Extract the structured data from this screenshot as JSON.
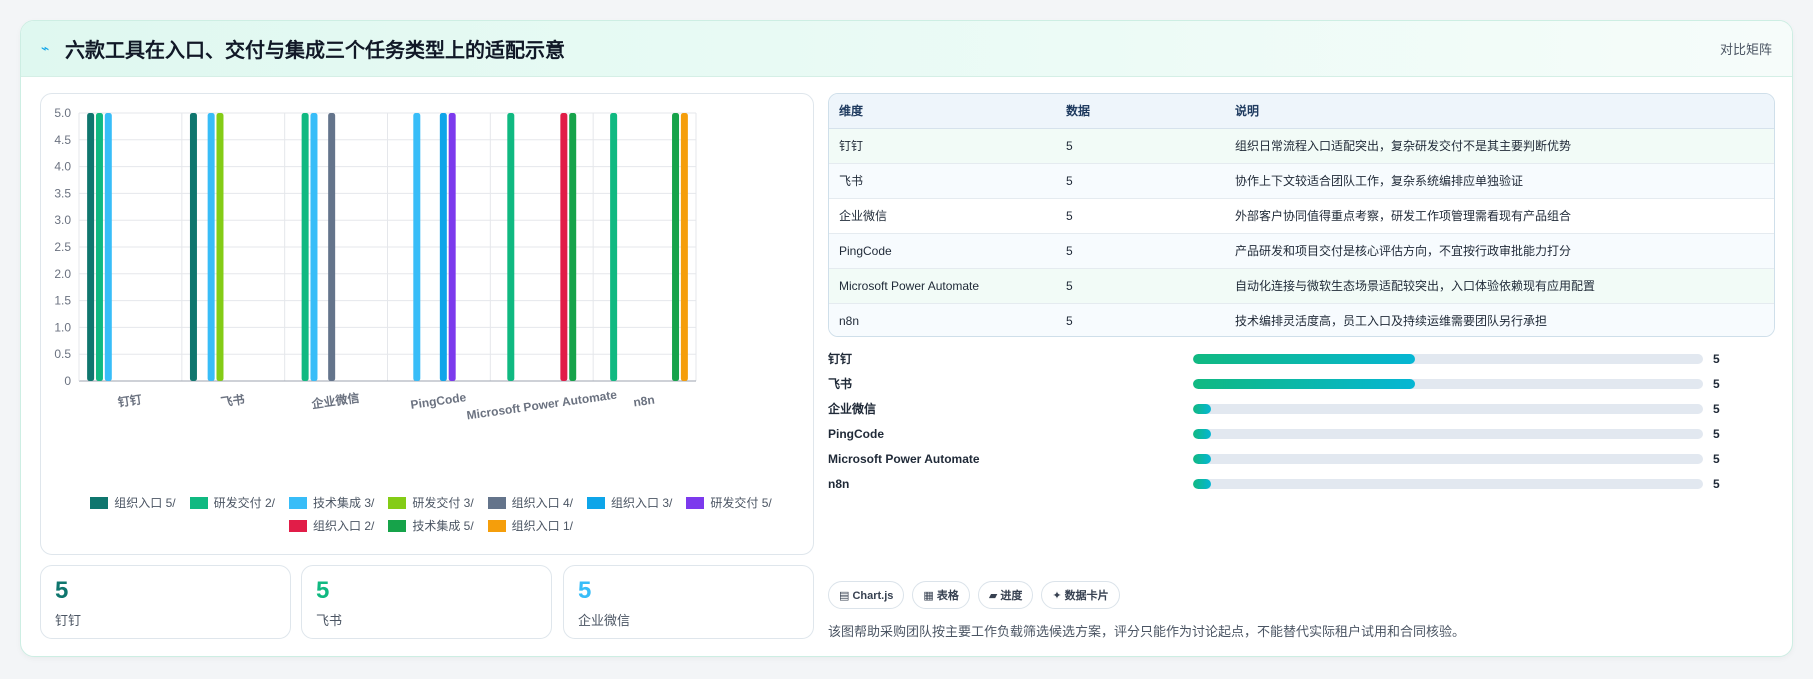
{
  "header": {
    "icon": "trend-icon",
    "title": "六款工具在入口、交付与集成三个任务类型上的适配示意",
    "link": "对比矩阵"
  },
  "chart_data": {
    "type": "bar",
    "categories": [
      "钉钉",
      "飞书",
      "企业微信",
      "PingCode",
      "Microsoft Power Automate",
      "n8n"
    ],
    "ylim": [
      0,
      5
    ],
    "yticks": [
      "0",
      "0.5",
      "1.0",
      "1.5",
      "2.0",
      "2.5",
      "3.0",
      "3.5",
      "4.0",
      "4.5",
      "5.0"
    ],
    "grid": true,
    "legend_position": "bottom",
    "series": [
      {
        "name": "组织入口 5/",
        "color": "#0f766e",
        "values": [
          5,
          5,
          null,
          null,
          null,
          null
        ]
      },
      {
        "name": "研发交付 2/",
        "color": "#10b981",
        "values": [
          5,
          null,
          5,
          null,
          5,
          5
        ]
      },
      {
        "name": "技术集成 3/",
        "color": "#38bdf8",
        "values": [
          5,
          5,
          5,
          5,
          null,
          null
        ]
      },
      {
        "name": "研发交付 3/",
        "color": "#84cc16",
        "values": [
          null,
          5,
          null,
          null,
          null,
          null
        ]
      },
      {
        "name": "组织入口 4/",
        "color": "#64748b",
        "values": [
          null,
          null,
          5,
          null,
          null,
          null
        ]
      },
      {
        "name": "组织入口 3/",
        "color": "#0ea5e9",
        "values": [
          null,
          null,
          null,
          5,
          null,
          null
        ]
      },
      {
        "name": "研发交付 5/",
        "color": "#7c3aed",
        "values": [
          null,
          null,
          null,
          5,
          null,
          null
        ]
      },
      {
        "name": "组织入口 2/",
        "color": "#e11d48",
        "values": [
          null,
          null,
          null,
          null,
          5,
          null
        ]
      },
      {
        "name": "技术集成 5/",
        "color": "#16a34a",
        "values": [
          null,
          null,
          null,
          null,
          5,
          5
        ]
      },
      {
        "name": "组织入口 1/",
        "color": "#f59e0b",
        "values": [
          null,
          null,
          null,
          null,
          null,
          5
        ]
      }
    ]
  },
  "stats": [
    {
      "value": "5",
      "label": "钉钉",
      "color": "#0f766e"
    },
    {
      "value": "5",
      "label": "飞书",
      "color": "#10b981"
    },
    {
      "value": "5",
      "label": "企业微信",
      "color": "#38bdf8"
    }
  ],
  "table": {
    "headers": [
      "维度",
      "数据",
      "说明"
    ],
    "rows": [
      [
        "钉钉",
        "5",
        "组织日常流程入口适配突出，复杂研发交付不是其主要判断优势"
      ],
      [
        "飞书",
        "5",
        "协作上下文较适合团队工作，复杂系统编排应单独验证"
      ],
      [
        "企业微信",
        "5",
        "外部客户协同值得重点考察，研发工作项管理需看现有产品组合"
      ],
      [
        "PingCode",
        "5",
        "产品研发和项目交付是核心评估方向，不宜按行政审批能力打分"
      ],
      [
        "Microsoft Power Automate",
        "5",
        "自动化连接与微软生态场景适配较突出，入口体验依赖现有应用配置"
      ],
      [
        "n8n",
        "5",
        "技术编排灵活度高，员工入口及持续运维需要团队另行承担"
      ]
    ]
  },
  "progress": [
    {
      "label": "钉钉",
      "value": "5",
      "fill": 0.435
    },
    {
      "label": "飞书",
      "value": "5",
      "fill": 0.435
    },
    {
      "label": "企业微信",
      "value": "5",
      "fill": 0.035
    },
    {
      "label": "PingCode",
      "value": "5",
      "fill": 0.035
    },
    {
      "label": "Microsoft Power Automate",
      "value": "5",
      "fill": 0.035
    },
    {
      "label": "n8n",
      "value": "5",
      "fill": 0.035
    }
  ],
  "tags": [
    "▤ Chart.js",
    "▦ 表格",
    "▰ 进度",
    "✦ 数据卡片"
  ],
  "footnote": "该图帮助采购团队按主要工作负载筛选候选方案，评分只能作为讨论起点，不能替代实际租户试用和合同核验。"
}
